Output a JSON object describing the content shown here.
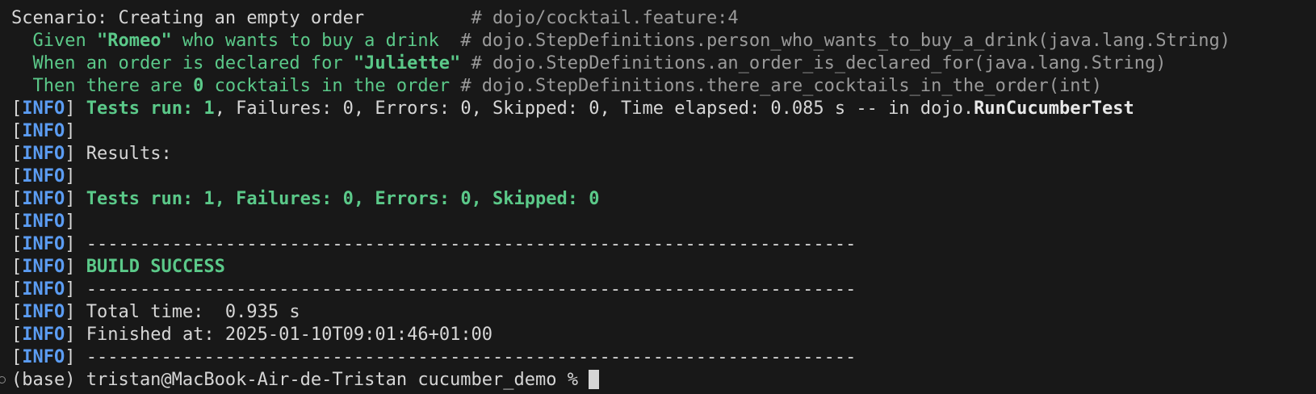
{
  "scenario": {
    "label": "Scenario: Creating an empty order",
    "location": "# dojo/cocktail.feature:4"
  },
  "steps": [
    {
      "keyword": "  Given ",
      "arg": "\"Romeo\"",
      "text_after": " who wants to buy a drink  ",
      "comment": "# dojo.StepDefinitions.person_who_wants_to_buy_a_drink(java.lang.String)"
    },
    {
      "keyword": "  When an order is declared for ",
      "arg": "\"Juliette\"",
      "text_after": "",
      "comment": "# dojo.StepDefinitions.an_order_is_declared_for(java.lang.String)"
    },
    {
      "keyword": "  Then there are ",
      "arg": "0",
      "text_after": " cocktails in the order ",
      "comment": "# dojo.StepDefinitions.there_are_cocktails_in_the_order(int)"
    }
  ],
  "info": {
    "open": "[",
    "word": "INFO",
    "close": "]"
  },
  "tests_line": {
    "tests_run": "Tests run: 1",
    "rest": ", Failures: 0, Errors: 0, Skipped: 0, Time elapsed: 0.085 s -- in dojo.",
    "class_name": "RunCucumberTest"
  },
  "results_label": "Results:",
  "summary": "Tests run: 1, Failures: 0, Errors: 0, Skipped: 0",
  "separator": "------------------------------------------------------------------------",
  "build_status": "BUILD SUCCESS",
  "total_time": "Total time:  0.935 s",
  "finished_at": "Finished at: 2025-01-10T09:01:46+01:00",
  "prompt": {
    "text": "(base) tristan@MacBook-Air-de-Tristan cucumber_demo % "
  }
}
